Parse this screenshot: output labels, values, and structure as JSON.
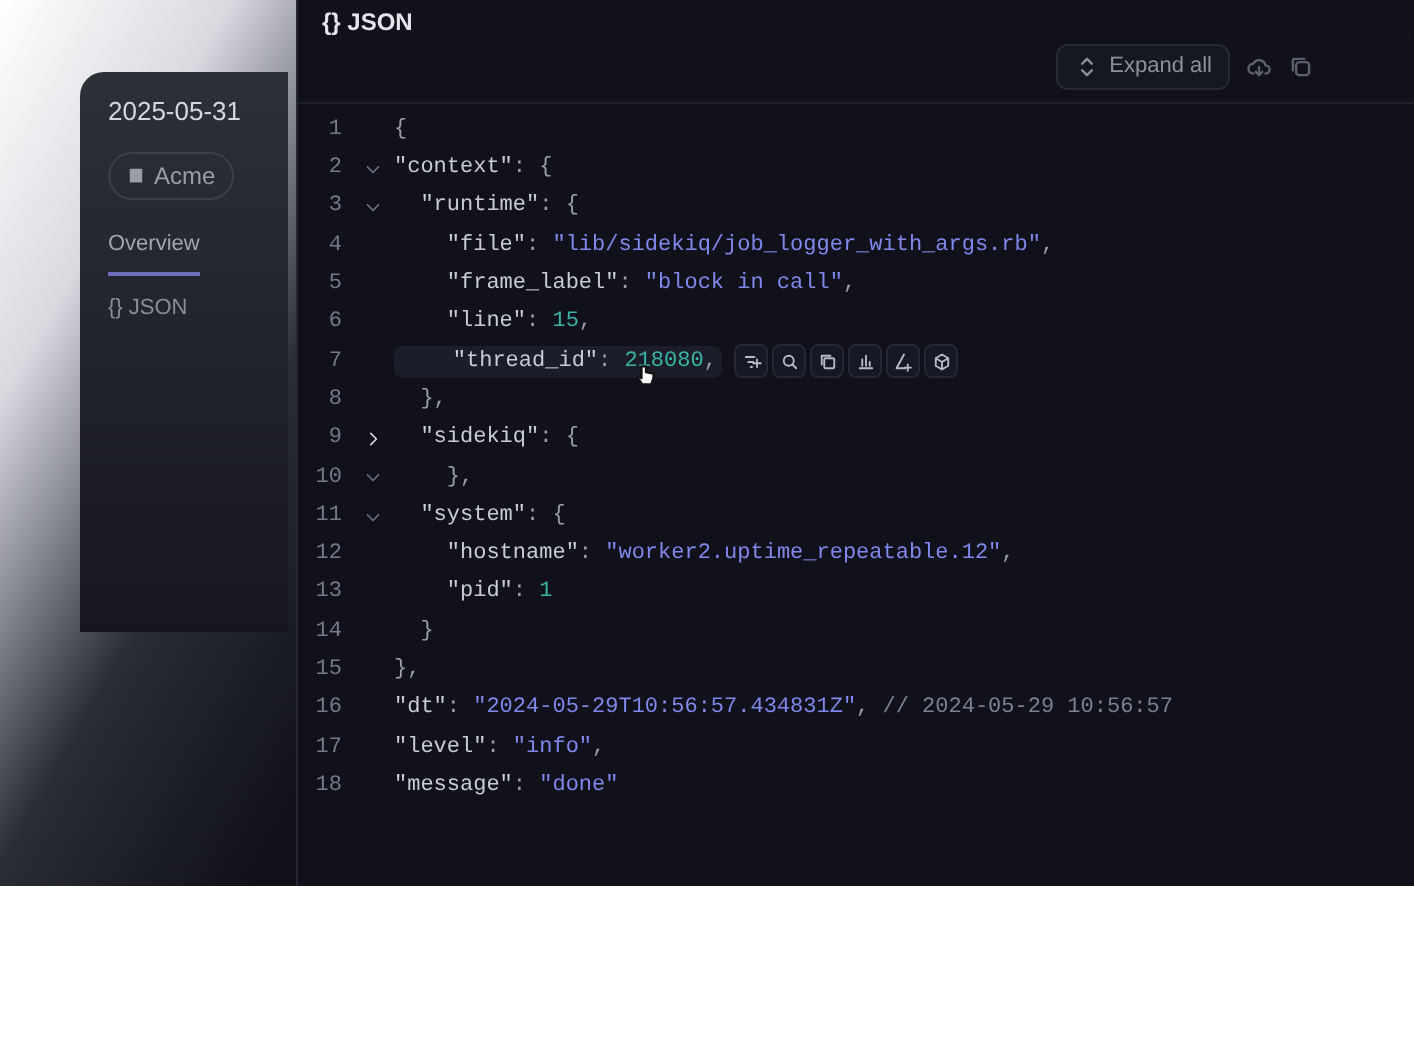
{
  "back_panel": {
    "date": "2025-05-31",
    "org": "Acme",
    "tab": "Overview",
    "section_title": "{} JSON"
  },
  "panel": {
    "title": "{} JSON",
    "toolbar": {
      "expand_label": "Expand all"
    },
    "lines": [
      {
        "number": "1",
        "hovered": false,
        "tokens": [
          {
            "kind": "punct",
            "text": "{"
          }
        ]
      },
      {
        "number": "2",
        "expanded": true,
        "hovered": false,
        "tokens": [
          {
            "kind": "key",
            "text": "\"context\""
          },
          {
            "kind": "punct",
            "text": ": {"
          }
        ]
      },
      {
        "number": "3",
        "expanded": true,
        "hovered": false,
        "tokens": [
          {
            "kind": "key",
            "text": "  \"runtime\""
          },
          {
            "kind": "punct",
            "text": ": {"
          }
        ]
      },
      {
        "number": "4",
        "hovered": false,
        "tokens": [
          {
            "kind": "key",
            "text": "    \"file\""
          },
          {
            "kind": "punct",
            "text": ": "
          },
          {
            "kind": "string",
            "text": "\"lib/sidekiq/job_logger_with_args.rb\""
          },
          {
            "kind": "punct",
            "text": ","
          }
        ]
      },
      {
        "number": "5",
        "hovered": false,
        "tokens": [
          {
            "kind": "key",
            "text": "    \"frame_label\""
          },
          {
            "kind": "punct",
            "text": ": "
          },
          {
            "kind": "string",
            "text": "\"block in call\""
          },
          {
            "kind": "punct",
            "text": ","
          }
        ]
      },
      {
        "number": "6",
        "hovered": false,
        "tokens": [
          {
            "kind": "key",
            "text": "    \"line\""
          },
          {
            "kind": "punct",
            "text": ": "
          },
          {
            "kind": "number",
            "text": "15"
          },
          {
            "kind": "punct",
            "text": ","
          }
        ]
      },
      {
        "number": "7",
        "hovered": true,
        "tokens": [
          {
            "kind": "key",
            "text": "    \"thread_id\""
          },
          {
            "kind": "punct",
            "text": ": "
          },
          {
            "kind": "number",
            "text": "218080"
          },
          {
            "kind": "punct",
            "text": ","
          }
        ]
      },
      {
        "number": "8",
        "hovered": false,
        "tokens": [
          {
            "kind": "punct",
            "text": "  },"
          }
        ]
      },
      {
        "number": "9",
        "expanded": false,
        "hovered": false,
        "tokens": [
          {
            "kind": "key",
            "text": "  \"sidekiq\""
          },
          {
            "kind": "punct",
            "text": ": {"
          }
        ]
      },
      {
        "number": "10",
        "expanded": true,
        "hovered": false,
        "tokens": [
          {
            "kind": "punct",
            "text": "    },"
          }
        ]
      },
      {
        "number": "11",
        "expanded": true,
        "hovered": false,
        "tokens": [
          {
            "kind": "key",
            "text": "  \"system\""
          },
          {
            "kind": "punct",
            "text": ": {"
          }
        ]
      },
      {
        "number": "12",
        "hovered": false,
        "tokens": [
          {
            "kind": "key",
            "text": "    \"hostname\""
          },
          {
            "kind": "punct",
            "text": ": "
          },
          {
            "kind": "string",
            "text": "\"worker2.uptime_repeatable.12\""
          },
          {
            "kind": "punct",
            "text": ","
          }
        ]
      },
      {
        "number": "13",
        "hovered": false,
        "tokens": [
          {
            "kind": "key",
            "text": "    \"pid\""
          },
          {
            "kind": "punct",
            "text": ": "
          },
          {
            "kind": "number",
            "text": "1"
          }
        ]
      },
      {
        "number": "14",
        "hovered": false,
        "tokens": [
          {
            "kind": "punct",
            "text": "  }"
          }
        ]
      },
      {
        "number": "15",
        "hovered": false,
        "tokens": [
          {
            "kind": "punct",
            "text": "},"
          }
        ]
      },
      {
        "number": "16",
        "hovered": false,
        "tokens": [
          {
            "kind": "key",
            "text": "\"dt\""
          },
          {
            "kind": "punct",
            "text": ": "
          },
          {
            "kind": "string",
            "text": "\"2024-05-29T10:56:57.434831Z\""
          },
          {
            "kind": "punct",
            "text": ", "
          },
          {
            "kind": "comment",
            "text": "// 2024-05-29 10:56:57"
          }
        ]
      },
      {
        "number": "17",
        "hovered": false,
        "tokens": [
          {
            "kind": "key",
            "text": "\"level\""
          },
          {
            "kind": "punct",
            "text": ": "
          },
          {
            "kind": "string",
            "text": "\"info\""
          },
          {
            "kind": "punct",
            "text": ","
          }
        ]
      },
      {
        "number": "18",
        "hovered": false,
        "tokens": [
          {
            "kind": "key",
            "text": "\"message\""
          },
          {
            "kind": "punct",
            "text": ": "
          },
          {
            "kind": "string",
            "text": "\"done\""
          }
        ]
      }
    ]
  }
}
